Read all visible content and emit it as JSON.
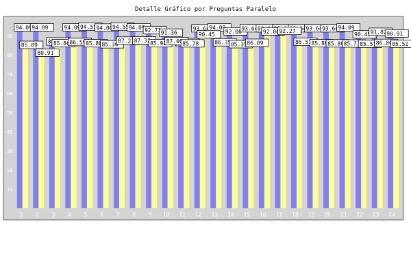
{
  "chart_data": {
    "type": "bar",
    "title": "Detalle Gráfico por Preguntas Paralelo",
    "categories": [
      "1",
      "2",
      "3",
      "4",
      "5",
      "6",
      "7",
      "8",
      "9",
      "10",
      "11",
      "12",
      "13",
      "14",
      "15",
      "16",
      "17",
      "18",
      "19",
      "20",
      "21",
      "22",
      "23",
      "24"
    ],
    "ylim": [
      0,
      100
    ],
    "yticks": [
      10,
      20,
      30,
      40,
      50,
      60,
      70,
      80,
      90
    ],
    "grid": false,
    "legend": "none",
    "series": [
      {
        "color": "#8080f0",
        "values": [
          94.09,
          94.09,
          86.8,
          94.09,
          94.55,
          94.0,
          94.55,
          94.09,
          92.73,
          91.36,
          86.43,
          93.64,
          94.09,
          92.0,
          93.64,
          93.64,
          93.64,
          93.64,
          93.64,
          93.64,
          94.09,
          90.45,
          91.82,
          90.91
        ],
        "labels": [
          "94.09",
          "94.09",
          "86.80",
          "94.09",
          "94.55",
          "94.00",
          "94.55",
          "94.09",
          "92.73",
          "91.36",
          "86.43",
          "93.64",
          "94.09",
          "92.00",
          "93.64",
          "93.64",
          "93.64",
          "93.64",
          "93.64",
          "93.64",
          "94.09",
          "90.45",
          "91.82",
          "90.91"
        ]
      },
      {
        "color": "#ffff90",
        "values": [
          85.0,
          80.91,
          85.86,
          86.5,
          85.88,
          85.3,
          87.21,
          87.32,
          85.92,
          87.0,
          85.78,
          90.45,
          86.35,
          85.35,
          86.09,
          92.0,
          92.27,
          86.57,
          85.88,
          85.8,
          85.71,
          85.57,
          86.0,
          85.52
        ],
        "labels": [
          "85.09",
          "80.91",
          "85.86",
          "86.59",
          "85.88",
          "85.30",
          "87.21",
          "87.32",
          "85.92",
          "87.00",
          "85.78",
          "90.45",
          "86.35",
          "85.35",
          "86.09",
          "92.00",
          "92.27",
          "86.57",
          "85.88",
          "85.80",
          "85.71",
          "85.57",
          "86.00",
          "85.52"
        ]
      }
    ]
  }
}
